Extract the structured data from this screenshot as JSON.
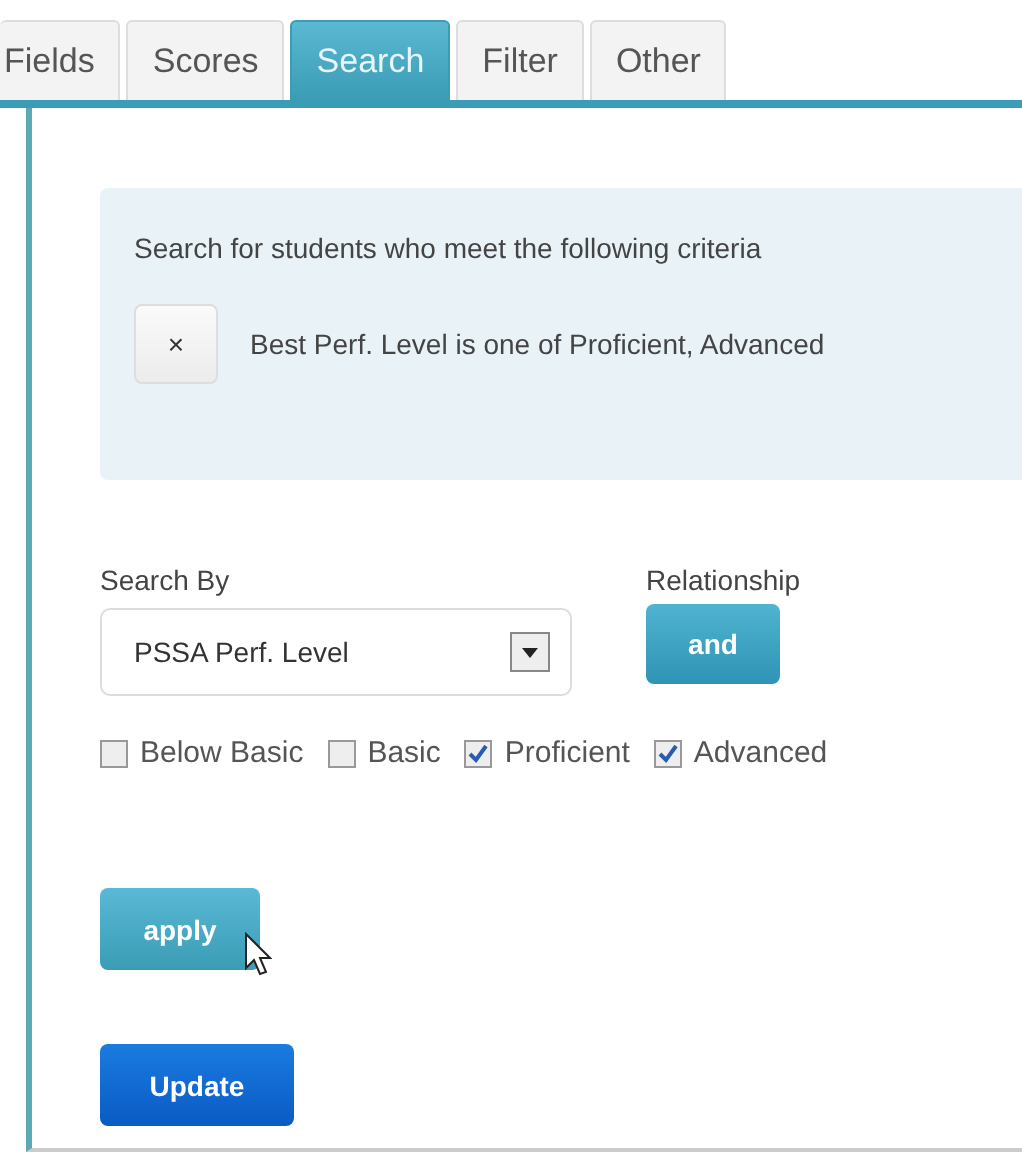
{
  "tabs": [
    {
      "label": "Fields",
      "selected": false
    },
    {
      "label": "Scores",
      "selected": false
    },
    {
      "label": "Search",
      "selected": true
    },
    {
      "label": "Filter",
      "selected": false
    },
    {
      "label": "Other",
      "selected": false
    }
  ],
  "criteria": {
    "heading": "Search for students who meet the following criteria",
    "items": [
      {
        "remove": "×",
        "text": "Best Perf. Level is one of Proficient, Advanced"
      }
    ]
  },
  "search_by": {
    "label": "Search By",
    "value": "PSSA Perf. Level"
  },
  "relationship": {
    "label": "Relationship",
    "button": "and"
  },
  "levels": [
    {
      "label": "Below Basic",
      "checked": false
    },
    {
      "label": "Basic",
      "checked": false
    },
    {
      "label": "Proficient",
      "checked": true
    },
    {
      "label": "Advanced",
      "checked": true
    }
  ],
  "apply_button": "apply",
  "update_button": "Update"
}
